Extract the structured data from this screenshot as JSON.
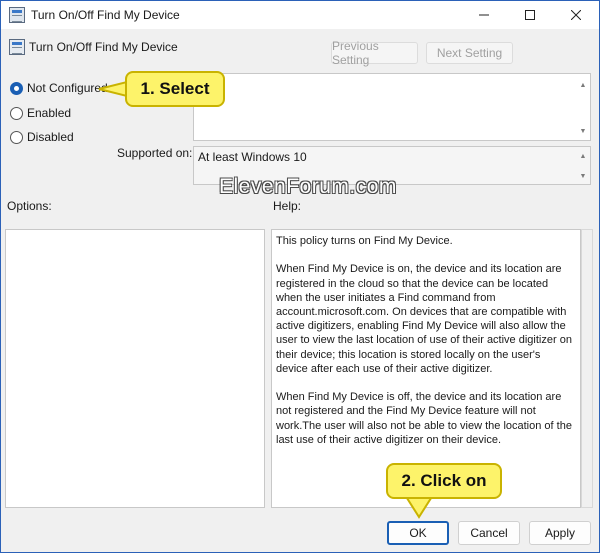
{
  "window": {
    "title": "Turn On/Off Find My Device",
    "minimize_icon": "minimize-icon",
    "maximize_icon": "maximize-icon",
    "close_icon": "close-icon"
  },
  "header": {
    "policy_name": "Turn On/Off Find My Device",
    "previous_setting": "Previous Setting",
    "next_setting": "Next Setting"
  },
  "state": {
    "options": [
      {
        "label": "Not Configured",
        "checked": true
      },
      {
        "label": "Enabled",
        "checked": false
      },
      {
        "label": "Disabled",
        "checked": false
      }
    ]
  },
  "supported_on": {
    "label": "Supported on:",
    "value": "At least Windows 10"
  },
  "panes": {
    "options_label": "Options:",
    "help_label": "Help:"
  },
  "help": {
    "paragraphs": [
      "This policy turns on Find My Device.",
      "When Find My Device is on, the device and its location are registered in the cloud so that the device can be located when the user initiates a Find command from account.microsoft.com. On devices that are compatible with active digitizers, enabling Find My Device will also allow the user to view the last location of use of their active digitizer on their device; this location is stored locally on the user's device after each use of their active digitizer.",
      "When Find My Device is off, the device and its location are not registered and the Find My Device feature will not work.The user will also not be able to view the location of the last use of their active digitizer on their device."
    ]
  },
  "footer": {
    "ok": "OK",
    "cancel": "Cancel",
    "apply": "Apply"
  },
  "watermark": "ElevenForum.com",
  "callouts": {
    "select": "1. Select",
    "click_on": "2. Click on"
  },
  "colors": {
    "accent": "#1a5fb4",
    "callout": "#fdf36a",
    "dialog_bg": "#f0f0f0"
  }
}
